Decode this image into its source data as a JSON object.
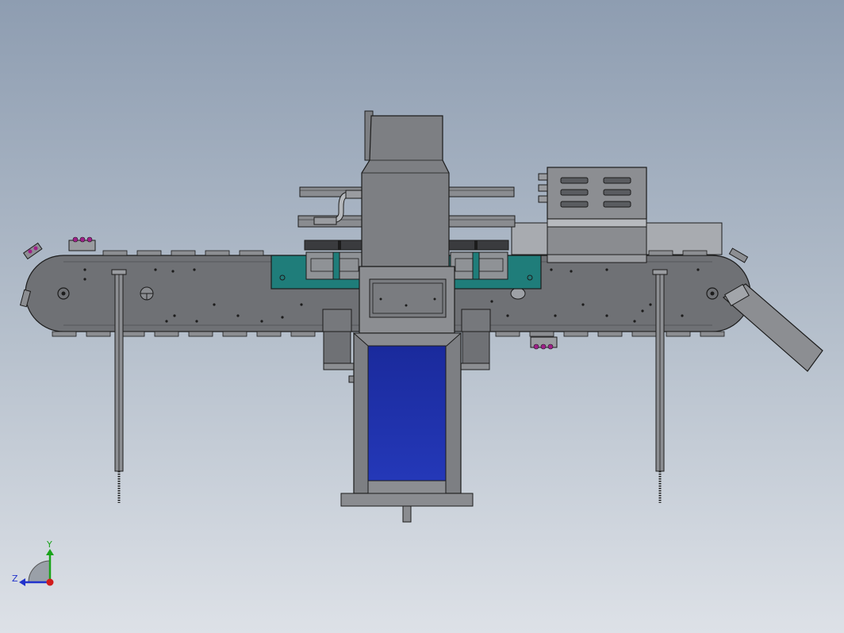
{
  "viewport": {
    "background_top": "#8e9db1",
    "background_bottom": "#dde1e7"
  },
  "model": {
    "frame_color": "#6f7175",
    "edge_color": "#1c1c1c",
    "panel_color": "#8c8e92",
    "accent_teal": "#1f7d7a",
    "accent_blue": "#1d2ea3",
    "cleat_accent": "#a0208a"
  },
  "triad": {
    "y_label": "Y",
    "z_label": "Z",
    "y_color": "#1aa31a",
    "z_color": "#2233cc",
    "x_color": "#d11c1c"
  }
}
